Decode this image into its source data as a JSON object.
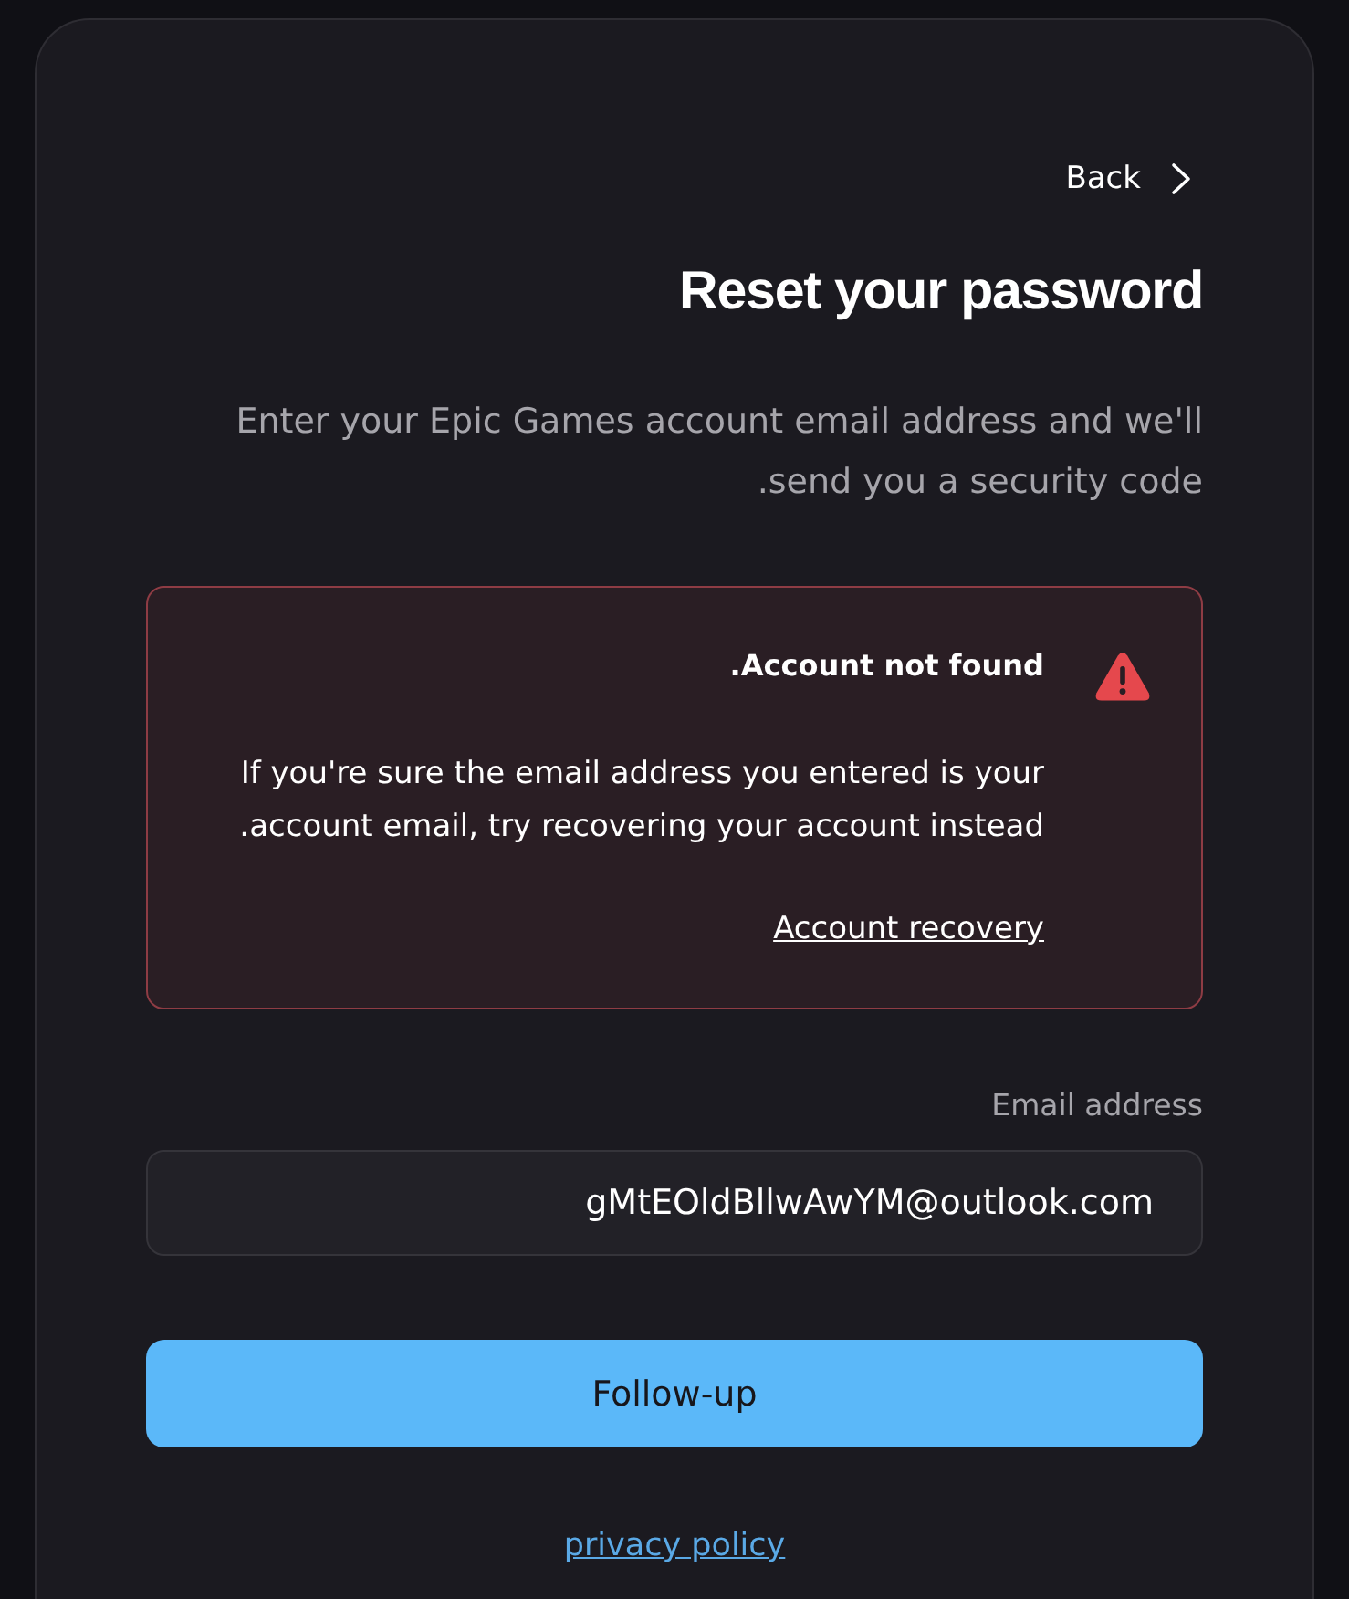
{
  "back_link": {
    "label": "Back"
  },
  "title": "Reset your password",
  "description": "Enter your Epic Games account email address and we'll send you a security code.",
  "alert": {
    "kind": "error",
    "title": "Account not found.",
    "message": "If you're sure the email address you entered is your account email, try recovering your account instead.",
    "link": "Account recovery"
  },
  "email_field": {
    "label": "Email address",
    "value": "gMtEOldBllwAwYM@outlook.com"
  },
  "submit_button": {
    "label": "Follow-up"
  },
  "footer_link": {
    "label": "privacy policy"
  }
}
